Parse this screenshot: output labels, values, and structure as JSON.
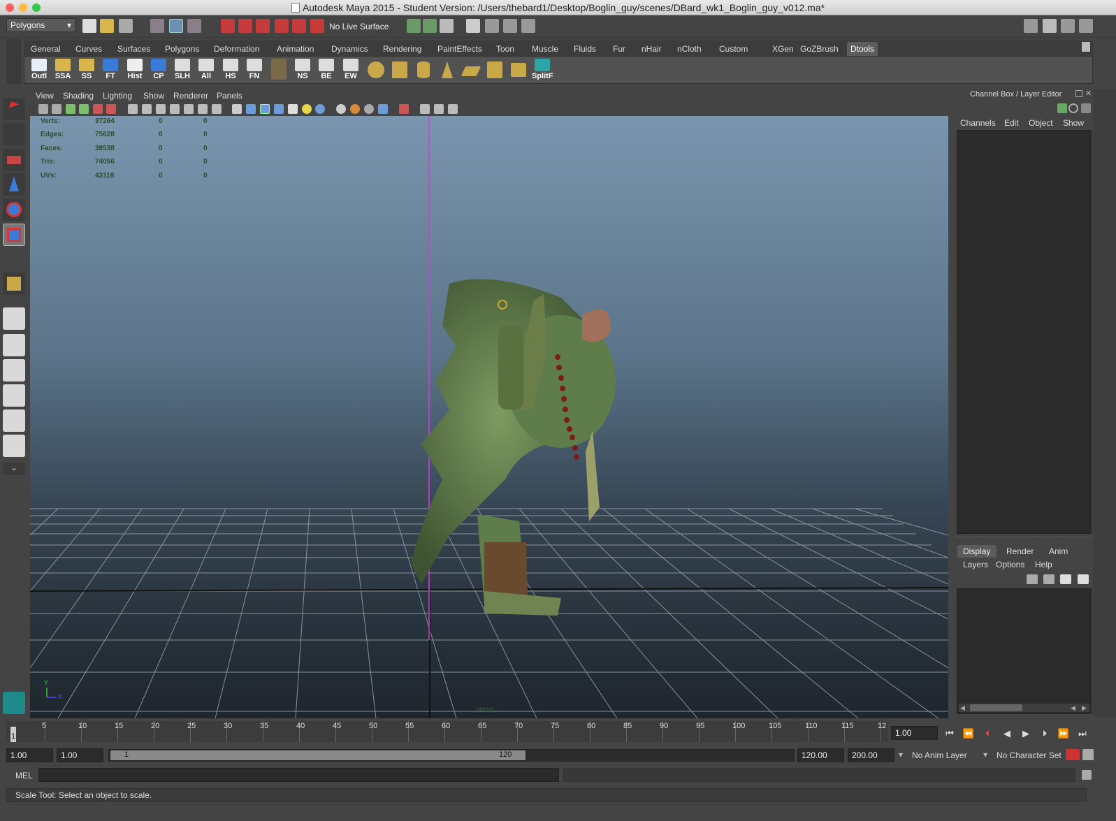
{
  "window": {
    "title": "Autodesk Maya 2015 - Student Version: /Users/thebard1/Desktop/Boglin_guy/scenes/DBard_wk1_Boglin_guy_v012.ma*"
  },
  "statusline": {
    "mode": "Polygons",
    "live_surface": "No Live Surface"
  },
  "shelf": {
    "tabs": [
      "General",
      "Curves",
      "Surfaces",
      "Polygons",
      "Deformation",
      "Animation",
      "Dynamics",
      "Rendering",
      "PaintEffects",
      "Toon",
      "Muscle",
      "Fluids",
      "Fur",
      "nHair",
      "nCloth",
      "Custom",
      "XGen",
      "GoZBrush",
      "Dtools"
    ],
    "active_tab": "Dtools",
    "buttons": [
      "Outl",
      "SSA",
      "SS",
      "FT",
      "Hist",
      "CP",
      "SLH",
      "All",
      "HS",
      "FN",
      "",
      "NS",
      "BE",
      "EW",
      "",
      "",
      "",
      "",
      "",
      "",
      "",
      "SplitF"
    ]
  },
  "viewport": {
    "menu": [
      "View",
      "Shading",
      "Lighting",
      "Show",
      "Renderer",
      "Panels"
    ],
    "hud": {
      "rows": [
        {
          "label": "Verts:",
          "v1": "37264",
          "v2": "0",
          "v3": "0"
        },
        {
          "label": "Edges:",
          "v1": "75628",
          "v2": "0",
          "v3": "0"
        },
        {
          "label": "Faces:",
          "v1": "38538",
          "v2": "0",
          "v3": "0"
        },
        {
          "label": "Tris:",
          "v1": "74056",
          "v2": "0",
          "v3": "0"
        },
        {
          "label": "UVs:",
          "v1": "43118",
          "v2": "0",
          "v3": "0"
        }
      ]
    },
    "camera_label": "persp",
    "axis": {
      "y": "Y",
      "x": "X"
    }
  },
  "channel_box": {
    "title": "Channel Box / Layer Editor",
    "menu": [
      "Channels",
      "Edit",
      "Object",
      "Show"
    ]
  },
  "layer_editor": {
    "tabs": [
      "Display",
      "Render",
      "Anim"
    ],
    "active_tab": "Display",
    "menu": [
      "Layers",
      "Options",
      "Help"
    ]
  },
  "time_slider": {
    "ticks": [
      "5",
      "10",
      "15",
      "20",
      "25",
      "30",
      "35",
      "40",
      "45",
      "50",
      "55",
      "60",
      "65",
      "70",
      "75",
      "80",
      "85",
      "90",
      "95",
      "100",
      "105",
      "110",
      "115",
      "12"
    ],
    "current_frame_marker": "1",
    "current_time": "1.00"
  },
  "range_slider": {
    "start": "1.00",
    "playback_start": "1.00",
    "range_start": "1",
    "range_end": "120",
    "playback_end": "120.00",
    "end": "200.00",
    "anim_layer": "No Anim Layer",
    "character_set": "No Character Set"
  },
  "command_line": {
    "label": "MEL"
  },
  "help_line": {
    "text": "Scale Tool: Select an object to scale."
  }
}
